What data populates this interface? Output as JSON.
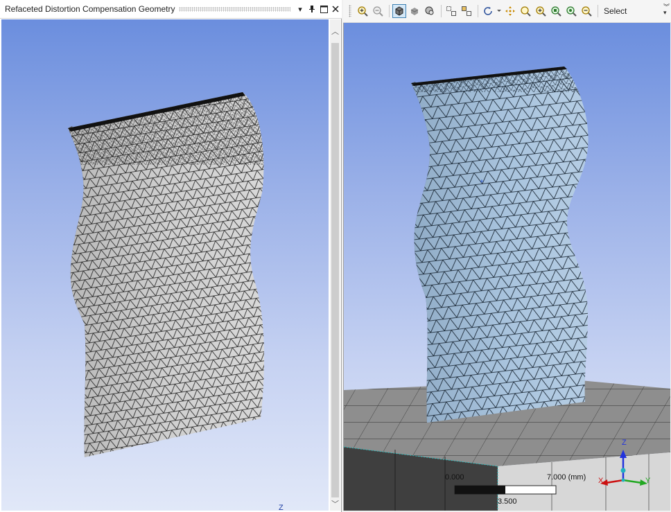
{
  "panel": {
    "title": "Refaceted Distortion Compensation Geometry"
  },
  "title_buttons": {
    "dropdown_glyph": "▾",
    "pin_glyph": "⊥",
    "maximize_glyph": "□",
    "close_glyph": "✕"
  },
  "scrollbar": {
    "up_glyph": "︿",
    "down_glyph": "﹀"
  },
  "toolbar": {
    "select_label": "Select",
    "icons": [
      "zoom-in-icon",
      "zoom-out-icon",
      "isometric-view-icon",
      "shaded-view-icon",
      "view-options-icon",
      "box-zoom-icon",
      "fit-box-icon",
      "rotate-icon",
      "pan-icon",
      "zoom-icon",
      "zoom-fit-icon",
      "zoom-all-icon",
      "zoom-selection-icon",
      "zoom-previous-icon"
    ]
  },
  "left_view": {
    "partial_axis_label": "Z"
  },
  "scale_bar": {
    "start": "0.000",
    "end": "7.000 (mm)",
    "mid": "3.500"
  },
  "triad": {
    "z": "Z",
    "x": "X",
    "y": "Y"
  },
  "colors": {
    "viewport_top": "#6b8ede",
    "viewport_bottom": "#e1e8f8",
    "mesh_left_fill": "#c8c8c8",
    "mesh_right_fill": "#a9c4de",
    "mesh_line": "#1a1a1a",
    "plate_fill": "#8c8c8c"
  }
}
